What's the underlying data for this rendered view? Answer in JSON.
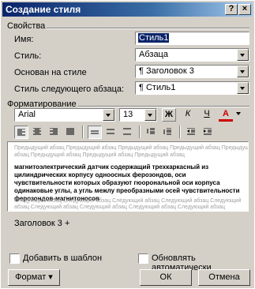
{
  "window": {
    "title": "Создание стиля",
    "help": "?",
    "close": "×"
  },
  "properties": {
    "group_label": "Свойства",
    "name_label": "Имя:",
    "name_value": "Стиль1",
    "type_label": "Стиль:",
    "type_value": "Абзаца",
    "based_on_label": "Основан на стиле",
    "based_on_value": "¶ Заголовок 3",
    "next_label": "Стиль следующего абзаца:",
    "next_value": "¶ Стиль1"
  },
  "formatting": {
    "group_label": "Форматирование",
    "font": "Arial",
    "size": "13",
    "bold": "Ж",
    "italic": "К",
    "underline": "Ч",
    "color_letter": "A",
    "font_color": "#cc0000"
  },
  "preview": {
    "prev_line1": "Предыдущий абзац Предыдущий абзац Предыдущий абзац Предыдущий абзац Предыдущий",
    "prev_line2": "абзац Предыдущий абзац Предыдущий абзац Предыдущий абзац",
    "sample": "магнитоэлектрический датчик содержащий трехкаркасный из цилиндрических корпусу одноосных ферозондов, оси чувствительности которых образуют гюорональной оси корпуса одинаковые углы, а угль межлу преобразными осей чувствительности ферозондов-магнитоносов",
    "next_line1": "Следующий абзац Следующий абзац Следующий абзац Следующий абзац Следующий",
    "next_line2": "абзац Следующий абзац Следующий абзац Следующий абзац Следующий абзац"
  },
  "description": "Заголовок 3 +",
  "options": {
    "add_to_template": "Добавить в шаблон",
    "auto_update": "Обновлять автоматически"
  },
  "buttons": {
    "format": "Формат ▾",
    "ok": "ОК",
    "cancel": "Отмена"
  }
}
